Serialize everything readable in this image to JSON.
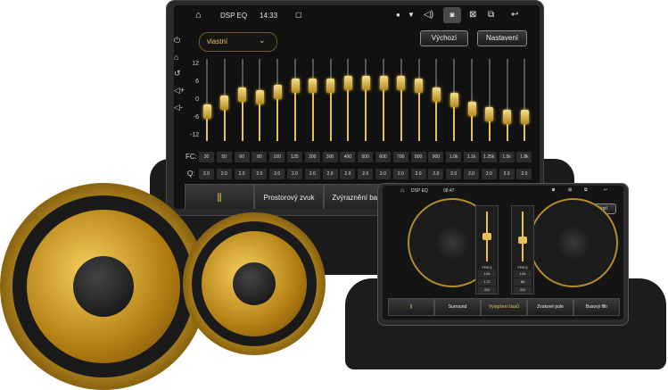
{
  "big_unit": {
    "status": {
      "title": "DSP EQ",
      "time": "14:33"
    },
    "preset_value": "vlastní",
    "default_button": "Výchozí",
    "settings_button": "Nastavení",
    "y_ticks": [
      "12",
      "6",
      "0",
      "-6",
      "-12"
    ],
    "fc_label": "FC:",
    "q_label": "Q:",
    "fc_values": [
      "30",
      "50",
      "60",
      "80",
      "100",
      "125",
      "200",
      "300",
      "400",
      "500",
      "600",
      "700",
      "800",
      "900",
      "1.0k",
      "1.1k",
      "1.25k",
      "1.5k",
      "1.8k"
    ],
    "q_values": [
      "2.0",
      "2.0",
      "2.0",
      "2.0",
      "2.0",
      "2.0",
      "2.0",
      "2.0",
      "2.0",
      "2.0",
      "2.0",
      "2.0",
      "2.0",
      "2.0",
      "2.0",
      "2.0",
      "2.0",
      "2.0",
      "2.0"
    ],
    "band_levels_db": [
      -4,
      -1,
      2,
      1,
      3,
      5,
      5,
      5,
      6,
      6,
      6,
      6,
      5,
      2,
      0,
      -3,
      -5,
      -6,
      -6
    ],
    "tabs": {
      "surround": "Prostorový zvuk",
      "bass": "Zvýraznění basů"
    }
  },
  "small_unit": {
    "status": {
      "title": "DSP EQ",
      "time": "08:47"
    },
    "default_button": "Výchozí",
    "tabs": [
      "Surround",
      "Vylepšení basů",
      "Zvukové pole",
      "Basový filtr"
    ],
    "active_tab": 1,
    "left_panel": {
      "label": "FREQ",
      "values": [
        "104",
        "172",
        "310"
      ]
    },
    "right_panel": {
      "label": "FREQ",
      "values": [
        "104",
        "86",
        "310"
      ]
    }
  },
  "colors": {
    "gold": "#e6c053",
    "screen": "#111111",
    "bezel": "#2a2a2a"
  },
  "icons": [
    "home-icon",
    "back-icon",
    "power-icon",
    "volume-icon",
    "close-icon",
    "window-icon",
    "pin-icon",
    "wifi-icon",
    "camera-icon",
    "eq-icon"
  ]
}
